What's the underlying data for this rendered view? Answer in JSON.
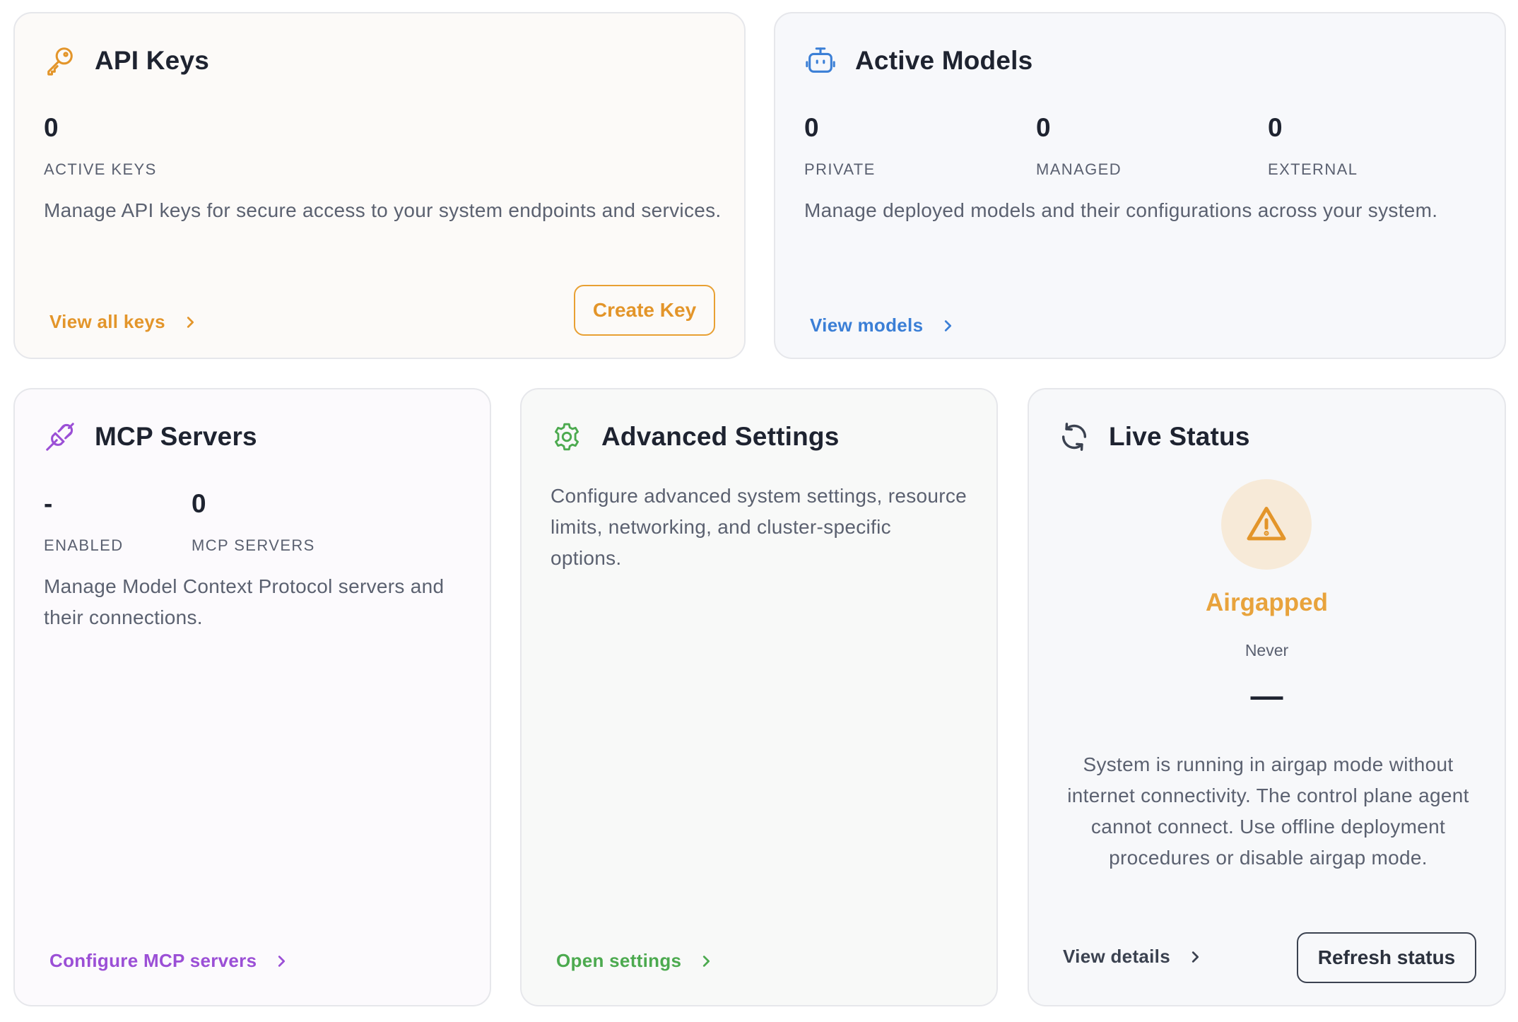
{
  "colors": {
    "orange": "#e3952a",
    "blue": "#3b7fd6",
    "purple": "#9b4fd6",
    "green": "#4caa4f",
    "dark": "#2b313d"
  },
  "api_keys": {
    "icon": "key-icon",
    "title": "API Keys",
    "stat_value": "0",
    "stat_label": "ACTIVE KEYS",
    "description": "Manage API keys for secure access to your system endpoints and services.",
    "link_label": "View all keys",
    "button_label": "Create Key"
  },
  "active_models": {
    "icon": "robot-icon",
    "title": "Active Models",
    "stats": [
      {
        "value": "0",
        "label": "PRIVATE"
      },
      {
        "value": "0",
        "label": "MANAGED"
      },
      {
        "value": "0",
        "label": "EXTERNAL"
      }
    ],
    "description": "Manage deployed models and their configurations across your system.",
    "link_label": "View models"
  },
  "mcp_servers": {
    "icon": "plug-icon",
    "title": "MCP Servers",
    "stats": [
      {
        "value": "-",
        "label": "ENABLED"
      },
      {
        "value": "0",
        "label": "MCP SERVERS"
      }
    ],
    "description": "Manage Model Context Protocol servers and their connections.",
    "link_label": "Configure MCP servers"
  },
  "advanced_settings": {
    "icon": "gear-icon",
    "title": "Advanced Settings",
    "description": "Configure advanced system settings, resource limits, networking, and cluster-specific options.",
    "link_label": "Open settings"
  },
  "live_status": {
    "icon": "refresh-icon",
    "title": "Live Status",
    "status_icon": "warning-icon",
    "status_label": "Airgapped",
    "last_checked": "Never",
    "metric": "—",
    "description": "System is running in airgap mode without internet connectivity. The control plane agent cannot connect. Use offline deployment procedures or disable airgap mode.",
    "link_label": "View details",
    "button_label": "Refresh status"
  }
}
